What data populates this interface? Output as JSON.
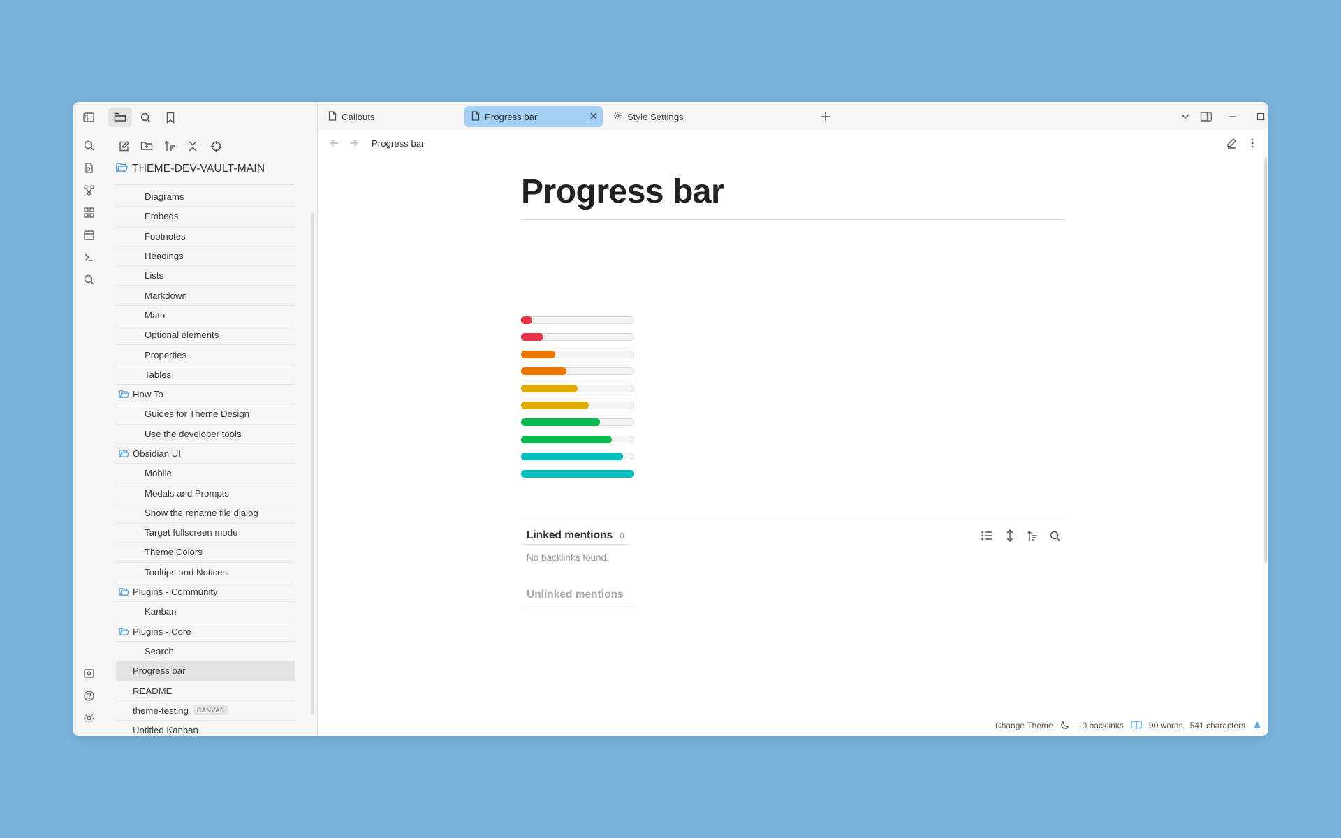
{
  "ribbon": {
    "top_icon": "sidebar-toggle-icon",
    "items": [
      "search-icon",
      "file-search-icon",
      "graph-icon",
      "grid-icon",
      "calendar-icon",
      "terminal-icon",
      "magnifier-icon"
    ],
    "bottom": [
      "vault-icon",
      "help-icon",
      "settings-icon"
    ]
  },
  "sidebar": {
    "tabs": [
      "files-icon",
      "search-icon",
      "bookmark-icon"
    ],
    "tools": [
      "new-note-icon",
      "new-folder-icon",
      "sort-icon",
      "collapse-icon",
      "locate-icon"
    ],
    "vault_name": "THEME-DEV-VAULT-MAIN",
    "tree": [
      {
        "label": "Diagrams",
        "level": 1
      },
      {
        "label": "Embeds",
        "level": 1
      },
      {
        "label": "Footnotes",
        "level": 1
      },
      {
        "label": "Headings",
        "level": 1
      },
      {
        "label": "Lists",
        "level": 1
      },
      {
        "label": "Markdown",
        "level": 1
      },
      {
        "label": "Math",
        "level": 1
      },
      {
        "label": "Optional elements",
        "level": 1
      },
      {
        "label": "Properties",
        "level": 1
      },
      {
        "label": "Tables",
        "level": 1
      },
      {
        "label": "How To",
        "level": 0,
        "folder": true
      },
      {
        "label": "Guides for Theme Design",
        "level": 1
      },
      {
        "label": "Use the developer tools",
        "level": 1
      },
      {
        "label": "Obsidian UI",
        "level": 0,
        "folder": true
      },
      {
        "label": "Mobile",
        "level": 1
      },
      {
        "label": "Modals and Prompts",
        "level": 1
      },
      {
        "label": "Show the rename file dialog",
        "level": 1
      },
      {
        "label": "Target fullscreen mode",
        "level": 1
      },
      {
        "label": "Theme Colors",
        "level": 1
      },
      {
        "label": "Tooltips and Notices",
        "level": 1
      },
      {
        "label": "Plugins - Community",
        "level": 0,
        "folder": true
      },
      {
        "label": "Kanban",
        "level": 1
      },
      {
        "label": "Plugins - Core",
        "level": 0,
        "folder": true
      },
      {
        "label": "Search",
        "level": 1
      },
      {
        "label": "Progress bar",
        "level": 0,
        "selected": true
      },
      {
        "label": "README",
        "level": 0
      },
      {
        "label": "theme-testing",
        "level": 0,
        "badge": "CANVAS"
      },
      {
        "label": "Untitled Kanban",
        "level": 0
      }
    ]
  },
  "tabs": [
    {
      "label": "Callouts",
      "icon": "file-icon",
      "active": false
    },
    {
      "label": "Progress bar",
      "icon": "file-icon",
      "active": true
    },
    {
      "label": "Style Settings",
      "icon": "gear-icon",
      "active": false
    }
  ],
  "breadcrumb": "Progress bar",
  "note": {
    "title": "Progress bar",
    "progress_values": [
      0.1,
      0.2,
      0.3,
      0.4,
      0.5,
      0.6,
      0.7,
      0.8,
      0.9,
      1.0
    ],
    "progress_colors": [
      "#e93147",
      "#e93147",
      "#ec7500",
      "#ec7500",
      "#e0ac00",
      "#e0ac00",
      "#08b94e",
      "#08b94e",
      "#00bfbc",
      "#00bfbc"
    ]
  },
  "backlinks": {
    "linked_title": "Linked mentions",
    "linked_count": "0",
    "empty_text": "No backlinks found.",
    "unlinked_title": "Unlinked mentions"
  },
  "status": {
    "change_theme": "Change Theme",
    "backlinks": "0 backlinks",
    "words": "90 words",
    "characters": "541 characters"
  },
  "colors": {
    "accent": "#a5d0f5",
    "desktop": "#7ab4dc",
    "folder_icon": "#4a9be0"
  }
}
